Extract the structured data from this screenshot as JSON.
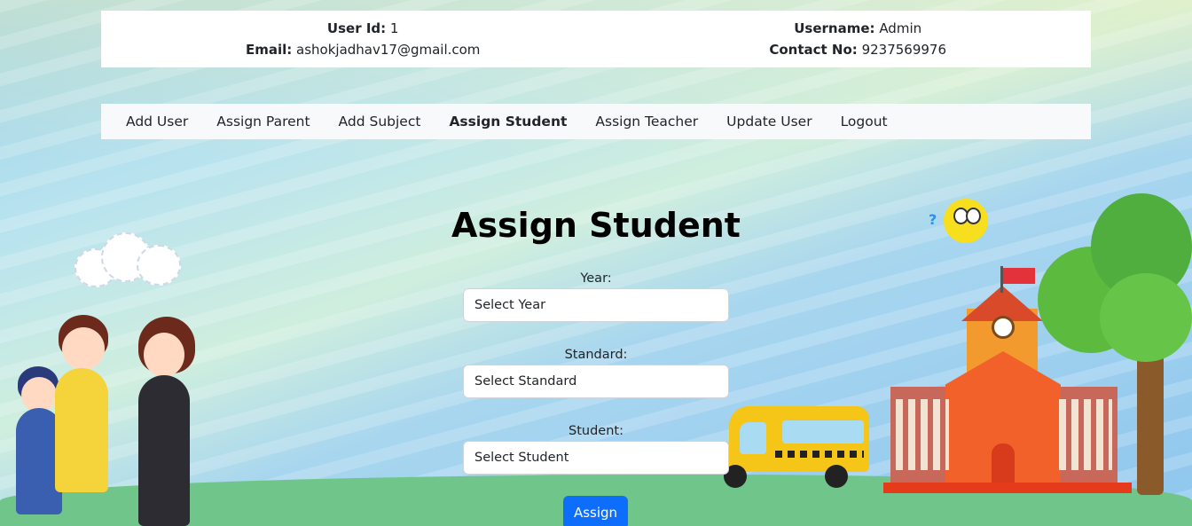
{
  "user_info": {
    "user_id_label": "User Id:",
    "user_id_value": "1",
    "email_label": "Email:",
    "email_value": "ashokjadhav17@gmail.com",
    "username_label": "Username:",
    "username_value": "Admin",
    "contact_label": "Contact No:",
    "contact_value": "9237569976"
  },
  "nav": {
    "items": [
      {
        "label": "Add User"
      },
      {
        "label": "Assign Parent"
      },
      {
        "label": "Add Subject"
      },
      {
        "label": "Assign Student",
        "active": true
      },
      {
        "label": "Assign Teacher"
      },
      {
        "label": "Update User"
      },
      {
        "label": "Logout"
      }
    ]
  },
  "page": {
    "title": "Assign Student"
  },
  "form": {
    "year_label": "Year:",
    "year_value": "Select Year",
    "standard_label": "Standard:",
    "standard_value": "Select Standard",
    "student_label": "Student:",
    "student_value": "Select Student",
    "submit_label": "Assign"
  },
  "colors": {
    "primary": "#0d6efd",
    "navbar_bg": "#f8f9fa"
  }
}
